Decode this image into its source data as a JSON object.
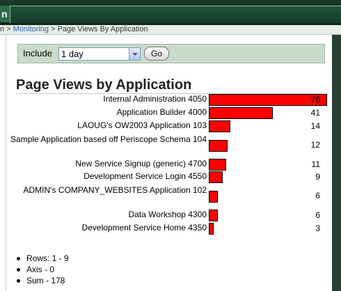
{
  "tab": {
    "label": "n"
  },
  "breadcrumb": {
    "prefix": "n > ",
    "monitoring": "Monitoring",
    "separator": " > ",
    "current": "Page Views By Application"
  },
  "filter": {
    "label": "Include",
    "selected": "1 day",
    "go_label": "Go"
  },
  "page_title": "Page Views by Application",
  "chart_data": {
    "type": "bar",
    "orientation": "horizontal",
    "categories": [
      "Internal Administration 4050",
      "Application Builder 4000",
      "LAOUG's OW2003 Application 103",
      "Sample Application based off Periscope Schema 104",
      "New Service Signup (generic) 4700",
      "Development Service Login 4550",
      "ADMIN's COMPANY_WEBSITES Application 102",
      "Data Workshop 4300",
      "Development Service Home 4350"
    ],
    "values": [
      76,
      41,
      14,
      12,
      11,
      9,
      6,
      6,
      3
    ],
    "bar_color": "#ff0000"
  },
  "stats": [
    "Rows: 1 - 9",
    "Axis - 0",
    "Sum - 178"
  ]
}
